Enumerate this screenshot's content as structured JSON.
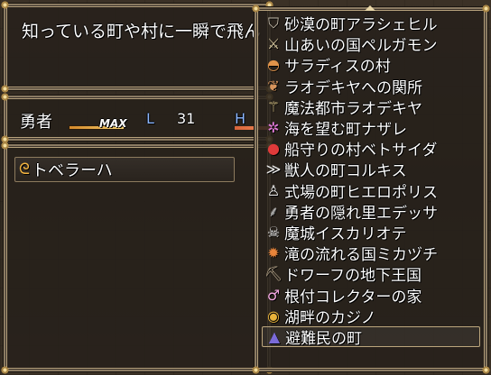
{
  "help": {
    "text": "知っている町や村に一瞬で飛ん"
  },
  "status": {
    "actor_name": "勇者",
    "max_label": "MAX",
    "level_label": "L",
    "level_value": "31",
    "hp_label": "H"
  },
  "skill": {
    "label": "トベラーハ",
    "icon": "curl-sparkle-icon",
    "glyph": "ᘓ"
  },
  "destinations": [
    {
      "label": "砂漠の町アラシェヒル",
      "icon": "shield-icon",
      "glyph": "⛉",
      "color": "#c9c1b0"
    },
    {
      "label": "山あいの国ペルガモン",
      "icon": "crossed-swords-icon",
      "glyph": "⚔",
      "color": "#d6c79e"
    },
    {
      "label": "サラディスの村",
      "icon": "pie-icon",
      "glyph": "◓",
      "color": "#e0934a"
    },
    {
      "label": "ラオデキヤへの関所",
      "icon": "meat-icon",
      "glyph": "❦",
      "color": "#d8955c"
    },
    {
      "label": "魔法都市ラオデキヤ",
      "icon": "wand-icon",
      "glyph": "⚚",
      "color": "#e6d08e"
    },
    {
      "label": "海を望む町ナザレ",
      "icon": "sparkle-icon",
      "glyph": "✲",
      "color": "#e07ad8"
    },
    {
      "label": "船守りの村ベトサイダ",
      "icon": "red-orb-icon",
      "glyph": "●",
      "color": "#e03a3a"
    },
    {
      "label": "獣人の町コルキス",
      "icon": "claw-icon",
      "glyph": "≫",
      "color": "#e9e9e9"
    },
    {
      "label": "式場の町ヒエロポリス",
      "icon": "dress-icon",
      "glyph": "♙",
      "color": "#f2f2f2"
    },
    {
      "label": "勇者の隠れ里エデッサ",
      "icon": "feather-icon",
      "glyph": "⸙",
      "color": "#c9c9c9"
    },
    {
      "label": "魔城イスカリオテ",
      "icon": "skull-icon",
      "glyph": "☠",
      "color": "#eeeeee"
    },
    {
      "label": "滝の流れる国ミカヅチ",
      "icon": "flame-sword-icon",
      "glyph": "✹",
      "color": "#e8843a"
    },
    {
      "label": "ドワーフの地下王国",
      "icon": "pickaxe-icon",
      "glyph": "⛏",
      "color": "#c9b79a"
    },
    {
      "label": "根付コレクターの家",
      "icon": "charm-icon",
      "glyph": "♂",
      "color": "#f2a6e0"
    },
    {
      "label": "湖畔のカジノ",
      "icon": "coin-icon",
      "glyph": "◉",
      "color": "#e8b33a"
    },
    {
      "label": "避難民の町",
      "icon": "wizard-hat-icon",
      "glyph": "▲",
      "color": "#7a6ad8"
    }
  ],
  "selected_index": 15
}
